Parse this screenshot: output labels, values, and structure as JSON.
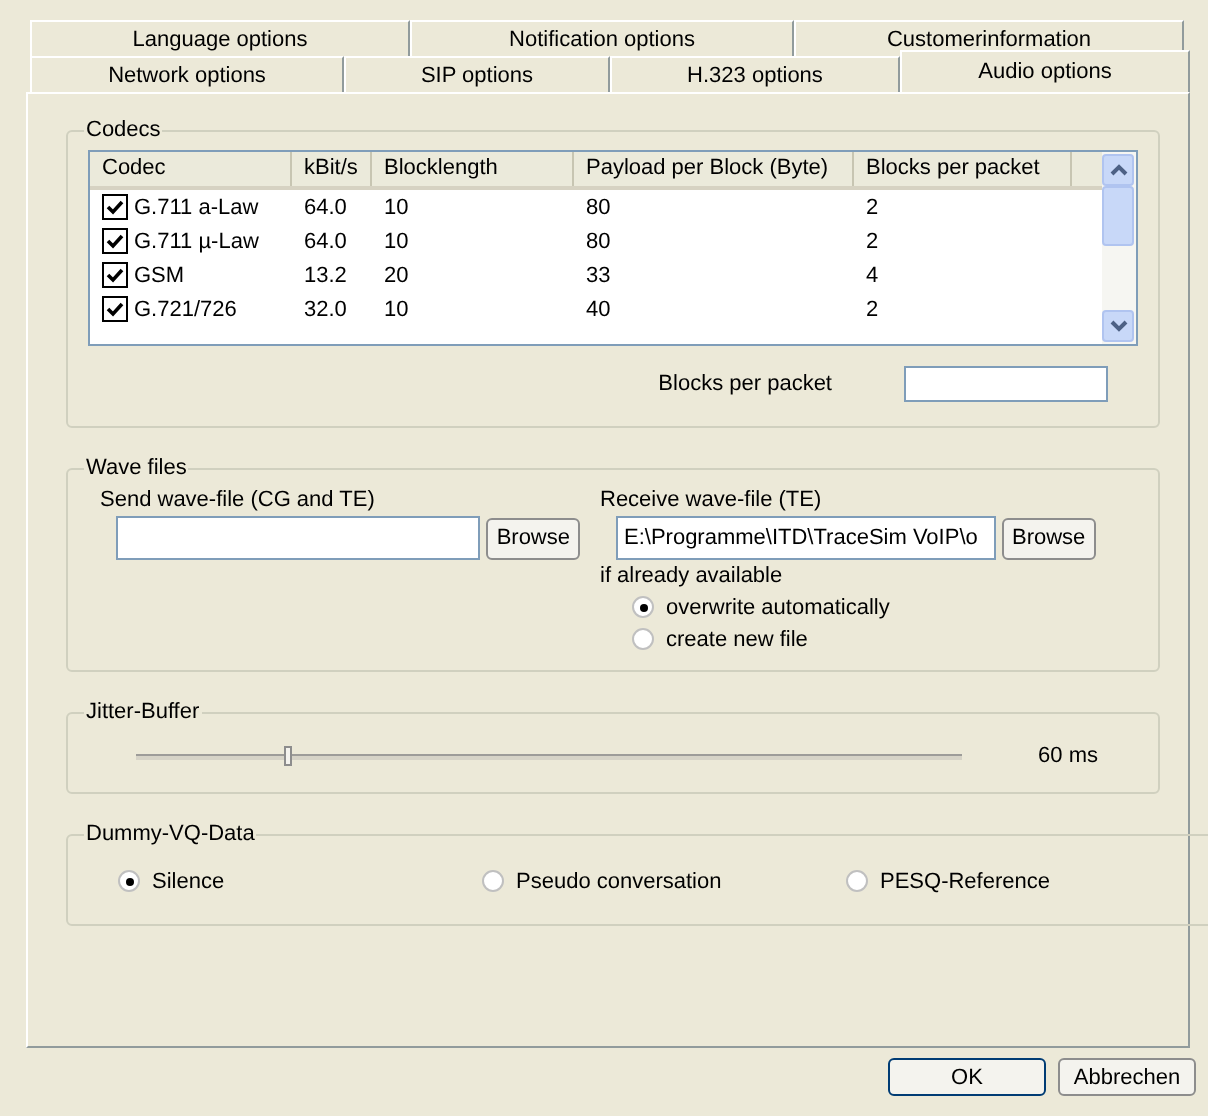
{
  "tabs": {
    "row_1": [
      {
        "label": "Language options",
        "selected": false
      },
      {
        "label": "Notification options",
        "selected": false
      },
      {
        "label": "Customerinformation",
        "selected": false
      }
    ],
    "row_2": [
      {
        "label": "Network options",
        "selected": false
      },
      {
        "label": "SIP options",
        "selected": false
      },
      {
        "label": "H.323 options",
        "selected": false
      },
      {
        "label": "Audio options",
        "selected": true
      }
    ]
  },
  "codecs": {
    "title": "Codecs",
    "table": {
      "columns": [
        "Codec",
        "kBit/s",
        "Blocklength",
        "Payload per Block (Byte)",
        "Blocks per packet"
      ],
      "rows": [
        {
          "checked": true,
          "cells": [
            "G.711 a-Law",
            "64.0",
            "10",
            "80",
            "2"
          ]
        },
        {
          "checked": true,
          "cells": [
            "G.711 µ-Law",
            "64.0",
            "10",
            "80",
            "2"
          ]
        },
        {
          "checked": true,
          "cells": [
            "GSM",
            "13.2",
            "20",
            "33",
            "4"
          ]
        },
        {
          "checked": true,
          "cells": [
            "G.721/726",
            "32.0",
            "10",
            "40",
            "2"
          ]
        }
      ]
    },
    "blocks_per_packet_label": "Blocks per packet"
  },
  "wave_files": {
    "title": "Wave files",
    "send": {
      "label": "Send wave-file (CG and TE)",
      "button": "Browse"
    },
    "receive": {
      "label": "Receive wave-file (TE)",
      "value": "E:\\Programme\\ITD\\TraceSim VoIP\\o",
      "button": "Browse"
    },
    "if_available_label": "if already available",
    "options": [
      {
        "label": "overwrite automatically",
        "selected": true
      },
      {
        "label": "create new file",
        "selected": false
      }
    ]
  },
  "jitter_buffer": {
    "title": "Jitter-Buffer",
    "level": 0.18,
    "reading": "60 ms"
  },
  "dummy_vq_data": {
    "title": "Dummy-VQ-Data",
    "options": [
      {
        "label": "Silence",
        "selected": true
      },
      {
        "label": "Pseudo conversation",
        "selected": false
      },
      {
        "label": "PESQ-Reference",
        "selected": false
      }
    ]
  },
  "buttons": [
    {
      "label": "OK",
      "kind": "default"
    },
    {
      "label": "Abbrechen",
      "kind": "normal"
    }
  ]
}
